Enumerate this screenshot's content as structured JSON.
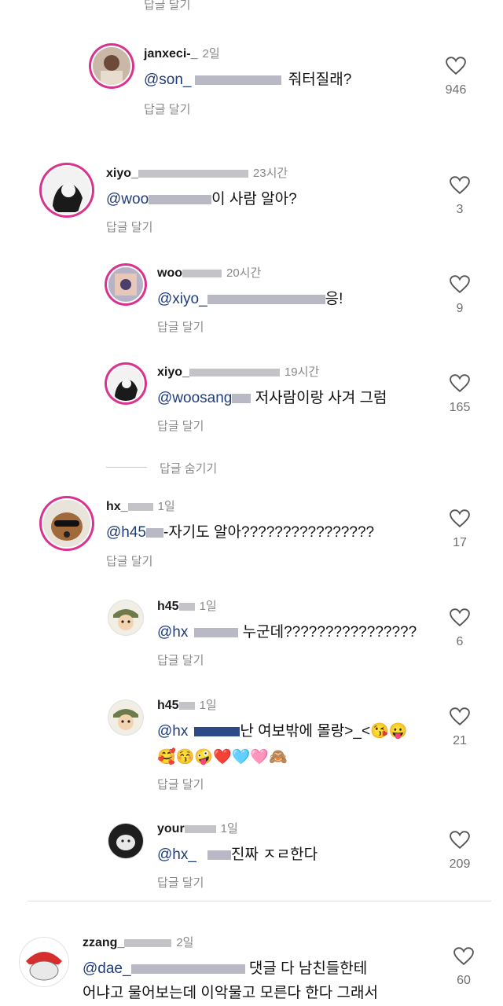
{
  "top_reply_label": "답글 달기",
  "hide_replies_label": "답글 숨기기",
  "comments": [
    {
      "user": "janxeci-_",
      "time": "2일",
      "mention": "@son_",
      "text": " 줘터질래?",
      "reply": "답글 달기",
      "likes": "946"
    },
    {
      "user": "xiyo_",
      "time": "23시간",
      "mention": "@woo",
      "text": "이 사람 알아?",
      "reply": "답글 달기",
      "likes": "3"
    },
    {
      "user": "woo",
      "time": "20시간",
      "mention": "@xiyo_",
      "text": "응!",
      "reply": "답글 달기",
      "likes": "9"
    },
    {
      "user": "xiyo_",
      "time": "19시간",
      "mention": "@woosang",
      "text": " 저사람이랑 사겨 그럼",
      "reply": "답글 달기",
      "likes": "165"
    },
    {
      "user": "hx_",
      "time": "1일",
      "mention": "@h45",
      "text": "-자기도 알아????????????????",
      "reply": "답글 달기",
      "likes": "17"
    },
    {
      "user": "h45",
      "time": "1일",
      "mention": "@hx",
      "text": " 누군데????????????????",
      "reply": "답글 달기",
      "likes": "6"
    },
    {
      "user": "h45",
      "time": "1일",
      "mention": "@hx",
      "text": "난 여보밖에 몰랑>_<😘😛",
      "text2": "🥰😚🤪❤️🩵🩷🙈",
      "reply": "답글 달기",
      "likes": "21"
    },
    {
      "user": "your",
      "time": "1일",
      "mention": "@hx_",
      "text": "진짜 ㅈㄹ한다",
      "reply": "답글 달기",
      "likes": "209"
    },
    {
      "user": "zzang_",
      "time": "2일",
      "mention": "@dae_",
      "text": " 댓글 다 남친들한테",
      "text2": "어냐고 물어보는데 이악물고 모른다 한다 그래서",
      "likes": "60"
    }
  ]
}
